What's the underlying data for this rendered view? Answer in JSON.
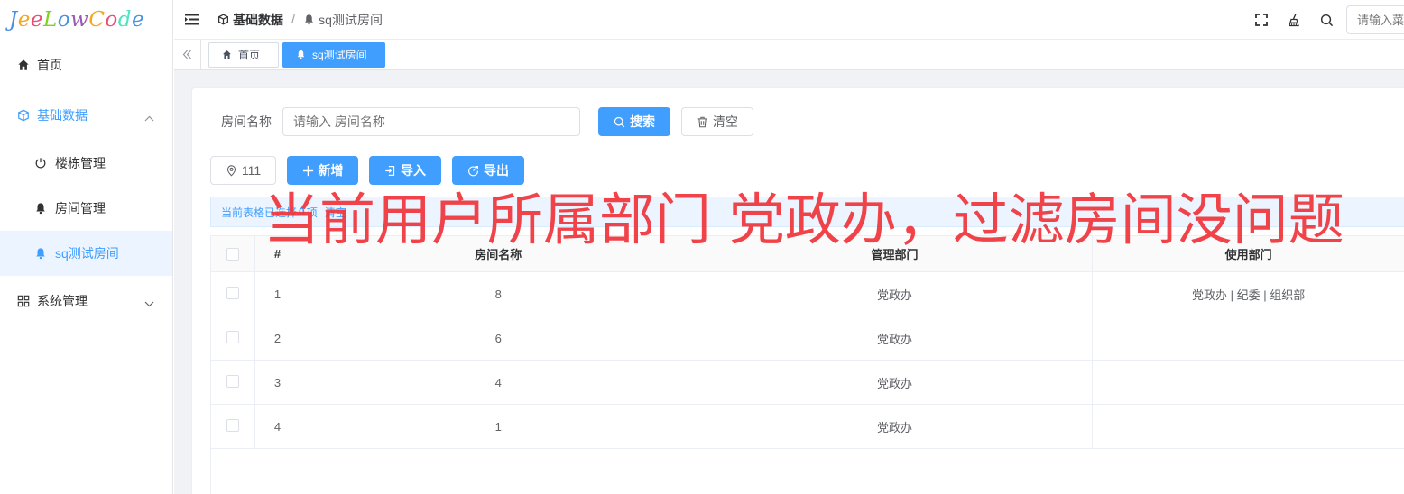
{
  "app": {
    "logo_letters": [
      {
        "ch": "J",
        "color": "#4a90e2"
      },
      {
        "ch": "e",
        "color": "#f5a623"
      },
      {
        "ch": "e",
        "color": "#e94e77"
      },
      {
        "ch": "L",
        "color": "#7ed321"
      },
      {
        "ch": "o",
        "color": "#4a90e2"
      },
      {
        "ch": "w",
        "color": "#9b59b6"
      },
      {
        "ch": "C",
        "color": "#f5a623"
      },
      {
        "ch": "o",
        "color": "#e94e77"
      },
      {
        "ch": "d",
        "color": "#50e3c2"
      },
      {
        "ch": "e",
        "color": "#4a90e2"
      }
    ]
  },
  "sidebar": {
    "home": "首页",
    "basic": "基础数据",
    "building": "楼栋管理",
    "room": "房间管理",
    "sq_room": "sq测试房间",
    "system": "系统管理"
  },
  "header": {
    "breadcrumb_parent": "基础数据",
    "breadcrumb_current": "sq测试房间",
    "search_placeholder": "请输入菜"
  },
  "tags": {
    "home": "首页",
    "current": "sq测试房间"
  },
  "form": {
    "label": "房间名称",
    "placeholder": "请输入 房间名称",
    "search_btn": "搜索",
    "clear_btn": "清空"
  },
  "toolbar": {
    "location": "111",
    "add": "新增",
    "import": "导入",
    "export": "导出"
  },
  "alert": {
    "prefix": "当前表格已选择",
    "count": "0",
    "unit": "项",
    "clear": "清空"
  },
  "table": {
    "headers": {
      "check": "",
      "index": "#",
      "name": "房间名称",
      "manage": "管理部门",
      "use": "使用部门"
    },
    "rows": [
      {
        "index": "1",
        "name": "8",
        "manage": "党政办",
        "use": "党政办 | 纪委 | 组织部"
      },
      {
        "index": "2",
        "name": "6",
        "manage": "党政办",
        "use": ""
      },
      {
        "index": "3",
        "name": "4",
        "manage": "党政办",
        "use": ""
      },
      {
        "index": "4",
        "name": "1",
        "manage": "党政办",
        "use": ""
      }
    ]
  },
  "annotation": {
    "text": "当前用户所属部门 党政办，过滤房间没问题"
  },
  "colors": {
    "primary": "#409eff",
    "annotation": "#f0343a"
  }
}
